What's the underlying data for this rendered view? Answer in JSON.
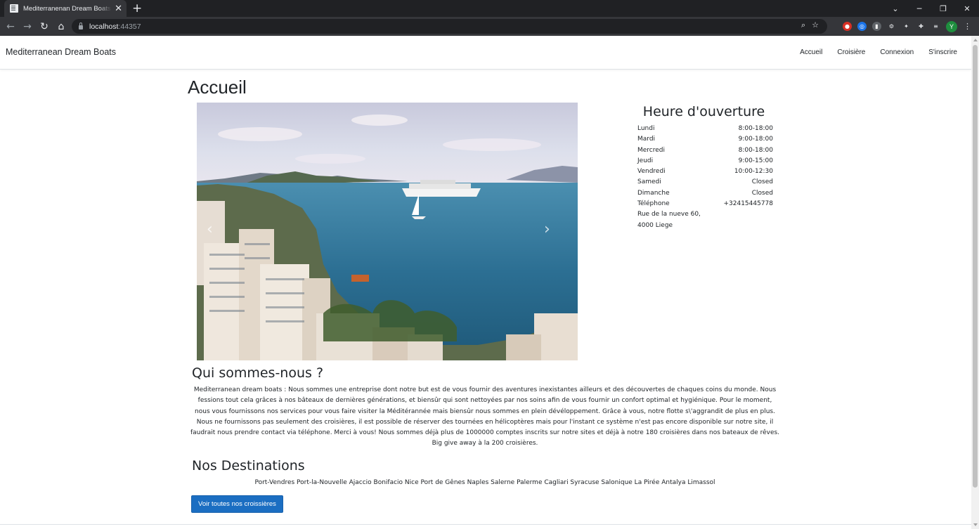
{
  "browser": {
    "tab_title": "Mediterranenan Dream Boats - A",
    "tab_close": "✕",
    "new_tab": "+",
    "url_host": "localhost",
    "url_port": ":44357",
    "profile_initial": "Y"
  },
  "site": {
    "brand": "Mediterranean Dream Boats",
    "nav": [
      "Accueil",
      "Croisière",
      "Connexion",
      "S'inscrire"
    ]
  },
  "page": {
    "title": "Accueil"
  },
  "carousel": {
    "prev_label": "‹",
    "next_label": "›"
  },
  "hours": {
    "title": "Heure d'ouverture",
    "rows": [
      {
        "label": "Lundi",
        "value": "8:00-18:00"
      },
      {
        "label": "Mardi",
        "value": "9:00-18:00"
      },
      {
        "label": "Mercredi",
        "value": "8:00-18:00"
      },
      {
        "label": "Jeudi",
        "value": "9:00-15:00"
      },
      {
        "label": "Vendredi",
        "value": "10:00-12:30"
      },
      {
        "label": "Samedi",
        "value": "Closed"
      },
      {
        "label": "Dimanche",
        "value": "Closed"
      },
      {
        "label": "Téléphone",
        "value": "+32415445778"
      }
    ],
    "address_line1": "Rue de la nueve 60,",
    "address_line2": "4000 Liege"
  },
  "about": {
    "title": "Qui sommes-nous ?",
    "text": "Mediterranean dream boats : Nous sommes une entreprise dont notre but est de vous fournir des aventures inexistantes ailleurs et des découvertes de chaques coins du monde. Nous fessions tout cela grâces à nos bâteaux de dernières générations, et biensûr qui sont nettoyées par nos soins afin de vous fournir un confort optimal et hygiénique. Pour le moment, nous vous fournissons nos services pour vous faire visiter la Méditérannée mais biensûr nous sommes en plein dévéloppement. Grâce à vous, notre flotte s\\'aggrandit de plus en plus. Nous ne fournissons pas seulement des croisières, il est possible de réserver des tournées en hélicoptères mais pour l'instant ce système n'est pas encore disponible sur notre site, il faudrait nous prendre contact via téléphone. Merci à vous! Nous sommes déjà plus de 1000000 comptes inscrits sur notre sites et déjà à notre 180 croisières dans nos bateaux de rêves.",
    "giveaway": "Big give away à la 200 croisières."
  },
  "destinations": {
    "title": "Nos Destinations",
    "list": "Port-Vendres Port-la-Nouvelle Ajaccio Bonifacio Nice Port de Gênes Naples Salerne Palerme Cagliari Syracuse Salonique La Pirée Antalya Limassol",
    "button": "Voir toutes nos croissières"
  },
  "colors": {
    "primary_button": "#1b6ec2",
    "chrome_dark": "#202124",
    "chrome_toolbar": "#35363a"
  }
}
